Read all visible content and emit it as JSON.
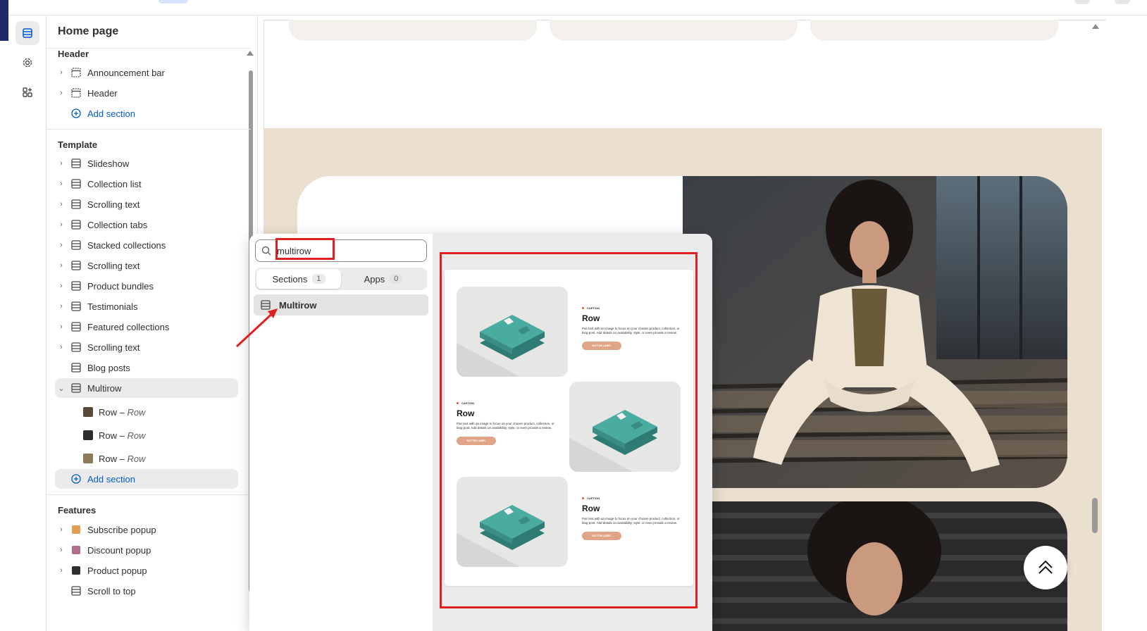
{
  "sidebar": {
    "title": "Home page",
    "header_group": "Header",
    "header_items": [
      "Announcement bar",
      "Header"
    ],
    "add_section": "Add section",
    "template_group": "Template",
    "template_items": [
      "Slideshow",
      "Collection list",
      "Scrolling text",
      "Collection tabs",
      "Stacked collections",
      "Scrolling text",
      "Product bundles",
      "Testimonials",
      "Featured collections",
      "Scrolling text",
      "Blog posts",
      "Multirow"
    ],
    "multirow_blocks": [
      {
        "label": "Row",
        "sublabel": "Row"
      },
      {
        "label": "Row",
        "sublabel": "Row"
      },
      {
        "label": "Row",
        "sublabel": "Row"
      }
    ],
    "row_separator": " – ",
    "features_group": "Features",
    "features_items": [
      "Subscribe popup",
      "Discount popup",
      "Product popup",
      "Scroll to top"
    ]
  },
  "popup": {
    "search_value": "multirow",
    "tabs": [
      {
        "label": "Sections",
        "count": "1"
      },
      {
        "label": "Apps",
        "count": "0"
      }
    ],
    "result": "Multirow",
    "preview_rows": [
      {
        "caption": "CAPTION",
        "heading": "Row",
        "text": "Pair text with an image to focus on your chosen product, collection, or blog post. Add details on availability, style, or even provide a review.",
        "button": "BUTTON LABEL"
      },
      {
        "caption": "CAPTION",
        "heading": "Row",
        "text": "Pair text with an image to focus on your chosen product, collection, or blog post. Add details on availability, style, or even provide a review.",
        "button": "BUTTON LABEL"
      },
      {
        "caption": "CAPTION",
        "heading": "Row",
        "text": "Pair text with an image to focus on your chosen product, collection, or blog post. Add details on availability, style, or even provide a review.",
        "button": "BUTTON LABEL"
      }
    ]
  },
  "colors": {
    "accent_link": "#005bd3",
    "highlight": "#e02020",
    "beige": "#ebdfd0",
    "button": "#e0a487",
    "product": "#4aaca0"
  }
}
